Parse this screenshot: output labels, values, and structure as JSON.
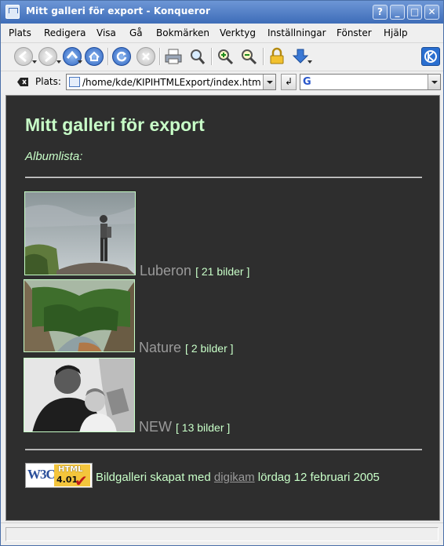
{
  "window": {
    "title": "Mitt galleri för export - Konqueror",
    "buttons": [
      "?",
      "_",
      "□",
      "✕"
    ]
  },
  "menu": [
    "Plats",
    "Redigera",
    "Visa",
    "Gå",
    "Bokmärken",
    "Verktyg",
    "Inställningar",
    "Fönster",
    "Hjälp"
  ],
  "location": {
    "label": "Plats:",
    "url": "/home/kde/KIPIHTMLExport/index.html",
    "go_symbol": "↲",
    "search_engine_glyph": "G"
  },
  "page": {
    "heading": "Mitt galleri för export",
    "subtitle": "Albumlista:",
    "albums": [
      {
        "name": "Luberon",
        "count": "[ 21 bilder ]"
      },
      {
        "name": "Nature",
        "count": "[ 2 bilder ]"
      },
      {
        "name": "NEW",
        "count": "[ 13 bilder ]"
      }
    ],
    "badge": {
      "w3c": "W3C",
      "html": "HTML",
      "version": "4.01",
      "check": "✔"
    },
    "footer_prefix": "Bildgalleri skapat med",
    "footer_link": "digikam",
    "footer_date": "lördag 12 februari 2005"
  },
  "colors": {
    "page_background": "#2e2e2e",
    "heading_text": "#c8ffc8",
    "album_name": "#9a9a9a",
    "titlebar": "#4e7cc4"
  },
  "icons": [
    "back-icon",
    "forward-icon",
    "up-icon",
    "home-icon",
    "reload-icon",
    "stop-icon",
    "print-icon",
    "find-icon",
    "zoom-in-icon",
    "zoom-out-icon",
    "lock-icon",
    "download-icon",
    "kde-logo-icon"
  ]
}
